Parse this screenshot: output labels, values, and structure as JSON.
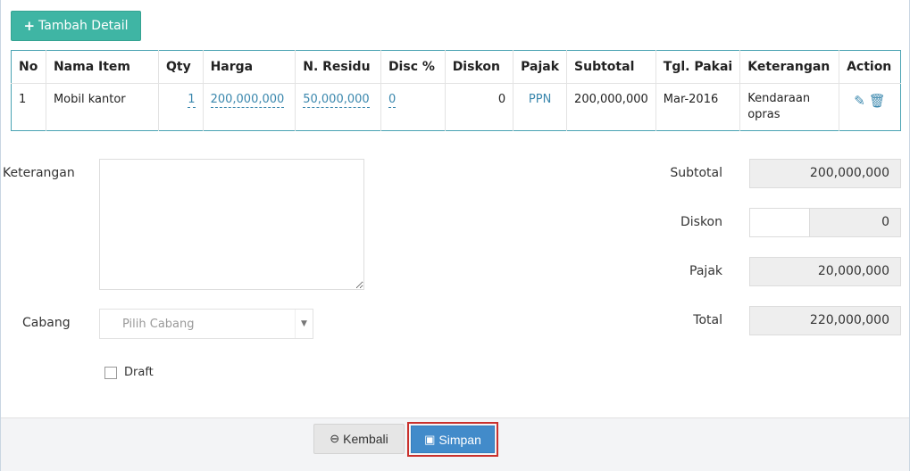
{
  "toolbar": {
    "add_detail_label": "Tambah Detail"
  },
  "table": {
    "headers": [
      "No",
      "Nama Item",
      "Qty",
      "Harga",
      "N. Residu",
      "Disc %",
      "Diskon",
      "Pajak",
      "Subtotal",
      "Tgl. Pakai",
      "Keterangan",
      "Action"
    ],
    "rows": [
      {
        "no": "1",
        "nama_item": "Mobil kantor",
        "qty": "1",
        "harga": "200,000,000",
        "n_residu": "50,000,000",
        "disc_pct": "0",
        "diskon": "0",
        "pajak": "PPN",
        "subtotal": "200,000,000",
        "tgl_pakai": "Mar-2016",
        "keterangan": "Kendaraan opras"
      }
    ]
  },
  "form": {
    "keterangan_label": "Keterangan",
    "cabang_label": "Cabang",
    "cabang_placeholder": "Pilih Cabang",
    "draft_label": "Draft"
  },
  "summary": {
    "subtotal_label": "Subtotal",
    "subtotal_value": "200,000,000",
    "diskon_label": "Diskon",
    "diskon_value": "0",
    "pajak_label": "Pajak",
    "pajak_value": "20,000,000",
    "total_label": "Total",
    "total_value": "220,000,000"
  },
  "footer": {
    "back_label": "Kembali",
    "save_label": "Simpan"
  },
  "icons": {
    "plus": "plus-icon",
    "edit": "pencil-icon",
    "delete": "trash-icon",
    "back": "circle-arrow-left-icon",
    "save": "floppy-disk-icon"
  },
  "colors": {
    "add_button": "#3fb5a4",
    "link": "#3a87ad",
    "save_button": "#428bca",
    "highlight_border": "#c9302c"
  }
}
